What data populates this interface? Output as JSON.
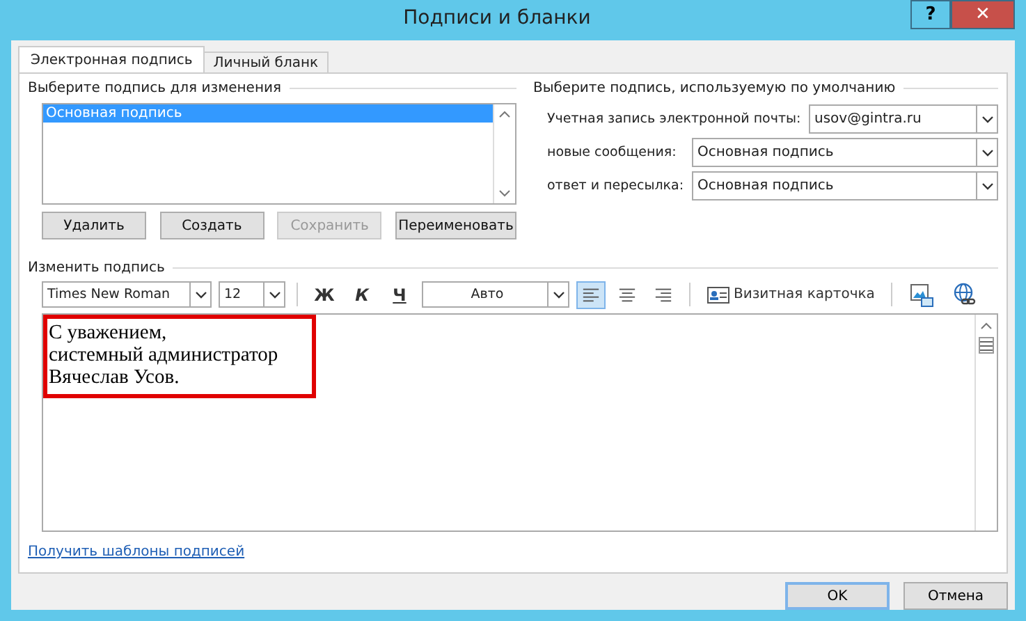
{
  "window": {
    "title": "Подписи и бланки",
    "help": "?",
    "close": "✕"
  },
  "tabs": [
    {
      "label": "Электронная подпись",
      "selected": true
    },
    {
      "label": "Личный бланк",
      "selected": false
    }
  ],
  "select_section": {
    "title": "Выберите подпись для изменения",
    "items": [
      {
        "label": "Основная подпись",
        "selected": true
      }
    ],
    "buttons": [
      {
        "label": "Удалить",
        "disabled": false
      },
      {
        "label": "Создать",
        "disabled": false
      },
      {
        "label": "Сохранить",
        "disabled": true
      },
      {
        "label": "Переименовать",
        "disabled": false
      }
    ]
  },
  "default_section": {
    "title": "Выберите подпись, используемую по умолчанию",
    "fields": [
      {
        "label": "Учетная запись электронной почты:",
        "value": "usov@gintra.ru"
      },
      {
        "label": "новые сообщения:",
        "value": "Основная подпись"
      },
      {
        "label": "ответ и пересылка:",
        "value": "Основная подпись"
      }
    ]
  },
  "edit_section": {
    "title": "Изменить подпись",
    "toolbar": [
      {
        "kind": "font",
        "value": "Times New Roman"
      },
      {
        "kind": "size",
        "value": "12"
      },
      {
        "kind": "sep"
      },
      {
        "kind": "style",
        "label": "Ж"
      },
      {
        "kind": "style",
        "label": "К"
      },
      {
        "kind": "style",
        "label": "Ч"
      },
      {
        "kind": "color",
        "value": "Авто"
      },
      {
        "kind": "align",
        "selected": true
      },
      {
        "kind": "align",
        "selected": false
      },
      {
        "kind": "align",
        "selected": false
      },
      {
        "kind": "sep"
      },
      {
        "kind": "card",
        "label": "Визитная карточка"
      },
      {
        "kind": "sep"
      },
      {
        "kind": "picture"
      },
      {
        "kind": "hyperlink"
      }
    ],
    "editor": {
      "lines": [
        "С уважением,",
        "системный администратор",
        "Вячеслав Усов."
      ],
      "highlighted": true
    }
  },
  "link": "Получить шаблоны подписей",
  "buttons": [
    {
      "label": "OK",
      "default": true
    },
    {
      "label": "Отмена",
      "default": false
    }
  ]
}
